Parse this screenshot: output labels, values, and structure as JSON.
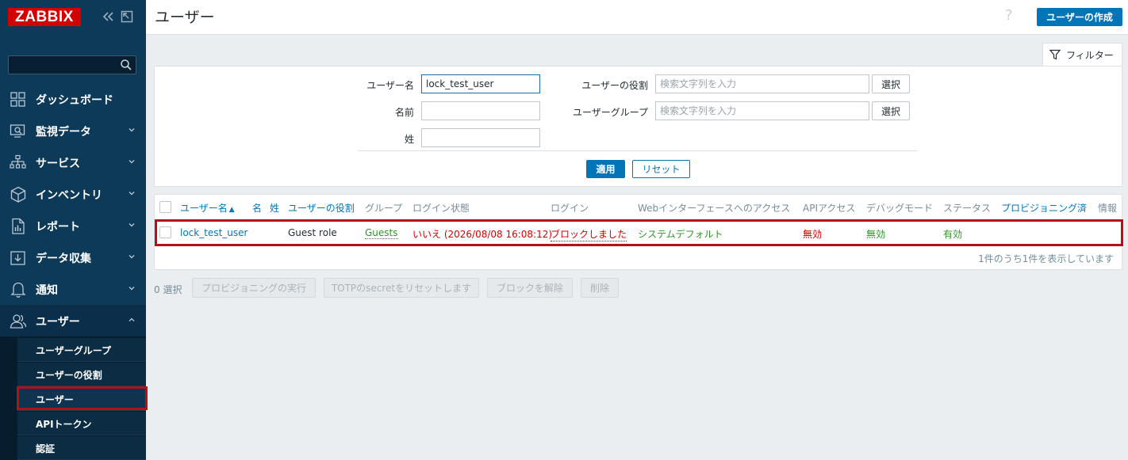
{
  "sidebar": {
    "logo": "ZABBIX",
    "search": {
      "placeholder": ""
    },
    "menu": [
      {
        "label": "ダッシュボード",
        "icon": "dashboard-icon",
        "has_arrow": false
      },
      {
        "label": "監視データ",
        "icon": "monitoring-icon",
        "has_arrow": true
      },
      {
        "label": "サービス",
        "icon": "services-icon",
        "has_arrow": true
      },
      {
        "label": "インベントリ",
        "icon": "inventory-icon",
        "has_arrow": true
      },
      {
        "label": "レポート",
        "icon": "reports-icon",
        "has_arrow": true
      },
      {
        "label": "データ収集",
        "icon": "data-collection-icon",
        "has_arrow": true
      },
      {
        "label": "通知",
        "icon": "alerts-icon",
        "has_arrow": true
      },
      {
        "label": "ユーザー",
        "icon": "users-icon",
        "has_arrow": true,
        "expanded": true
      }
    ],
    "submenu": [
      {
        "label": "ユーザーグループ"
      },
      {
        "label": "ユーザーの役割"
      },
      {
        "label": "ユーザー",
        "active": true
      },
      {
        "label": "APIトークン"
      },
      {
        "label": "認証"
      }
    ]
  },
  "header": {
    "title": "ユーザー",
    "help": "?",
    "create_button": "ユーザーの作成"
  },
  "filter": {
    "tab_label": "フィルター",
    "username_label": "ユーザー名",
    "username_value": "lock_test_user",
    "name_label": "名前",
    "name_value": "",
    "surname_label": "姓",
    "surname_value": "",
    "role_label": "ユーザーの役割",
    "role_placeholder": "検索文字列を入力",
    "group_label": "ユーザーグループ",
    "group_placeholder": "検索文字列を入力",
    "select_label": "選択",
    "apply_label": "適用",
    "reset_label": "リセット"
  },
  "table": {
    "columns": {
      "username": "ユーザー名",
      "sort_arrow": "▲",
      "name": "名",
      "surname": "姓",
      "role": "ユーザーの役割",
      "groups": "グループ",
      "login_status": "ログイン状態",
      "login": "ログイン",
      "frontend_access": "Webインターフェースへのアクセス",
      "api_access": "APIアクセス",
      "debug_mode": "デバッグモード",
      "status": "ステータス",
      "provisioned": "プロビジョニング済",
      "info": "情報"
    },
    "rows": [
      {
        "username": "lock_test_user",
        "name": "",
        "surname": "",
        "role": "Guest role",
        "groups": "Guests",
        "login_status": "いいえ (2026/08/08 16:08:12)",
        "login": "ブロックしました",
        "frontend_access": "システムデフォルト",
        "api_access": "無効",
        "debug_mode": "無効",
        "status": "有効"
      }
    ],
    "footer": "1件のうち1件を表示しています"
  },
  "actions": {
    "selected": "0 選択",
    "provision": "プロビジョニングの実行",
    "reset_totp": "TOTPのsecretをリセットします",
    "unblock": "ブロックを解除",
    "delete": "削除"
  },
  "colors": {
    "sidebar": "#0e3a5a",
    "primary": "#0275b8",
    "highlight": "#b01218",
    "green": "#2f9628",
    "red": "#d40000"
  }
}
